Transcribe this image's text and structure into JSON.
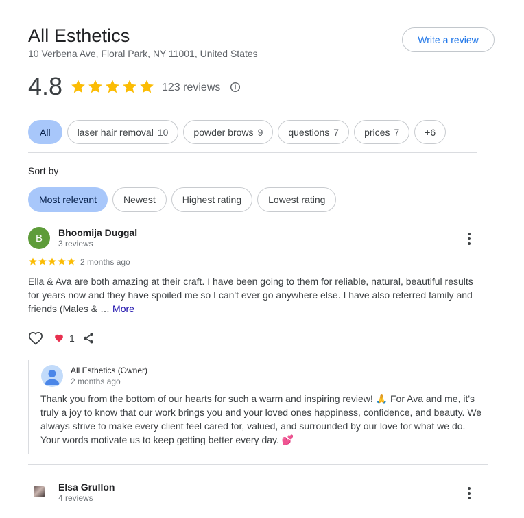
{
  "business": {
    "name": "All Esthetics",
    "address": "10 Verbena Ave, Floral Park, NY 11001, United States",
    "write_review_label": "Write a review"
  },
  "rating": {
    "value": "4.8",
    "stars_filled": 5,
    "review_count_text": "123 reviews",
    "info_icon": "info-icon",
    "star_color": "#fbbc04"
  },
  "topics": [
    {
      "label": "All",
      "count": "",
      "active": true
    },
    {
      "label": "laser hair removal",
      "count": "10",
      "active": false
    },
    {
      "label": "powder brows",
      "count": "9",
      "active": false
    },
    {
      "label": "questions",
      "count": "7",
      "active": false
    },
    {
      "label": "prices",
      "count": "7",
      "active": false
    },
    {
      "label": "+6",
      "count": "",
      "active": false
    }
  ],
  "sort": {
    "label": "Sort by",
    "options": [
      {
        "label": "Most relevant",
        "active": true
      },
      {
        "label": "Newest",
        "active": false
      },
      {
        "label": "Highest rating",
        "active": false
      },
      {
        "label": "Lowest rating",
        "active": false
      }
    ]
  },
  "reviews": [
    {
      "avatar_letter": "B",
      "avatar_color": "#5e9c3a",
      "name": "Bhoomija Duggal",
      "subtitle": "3 reviews",
      "stars": 5,
      "time": "2 months ago",
      "text": "Ella & Ava are both amazing at their craft. I have been going to them for reliable, natural, beautiful results for years now and they have spoiled me so I can't ever go anywhere else. I have also referred family and friends (Males & …",
      "more_label": "More",
      "like_count": "1",
      "owner_reply": {
        "name": "All Esthetics (Owner)",
        "time": "2 months ago",
        "text": "Thank you from the bottom of our hearts for such a warm and inspiring review! 🙏 For Ava and me, it's truly a joy to know that our work brings you and your loved ones happiness, confidence, and beauty. We always strive to make every client feel cared for, valued, and surrounded by our love for what we do. Your words motivate us to keep getting better every day. 💕"
      }
    },
    {
      "name": "Elsa Grullon",
      "subtitle": "4 reviews"
    }
  ],
  "colors": {
    "accent_blue": "#1a73e8",
    "chip_active_bg": "#a8c7fa",
    "like_red": "#e8304f"
  }
}
